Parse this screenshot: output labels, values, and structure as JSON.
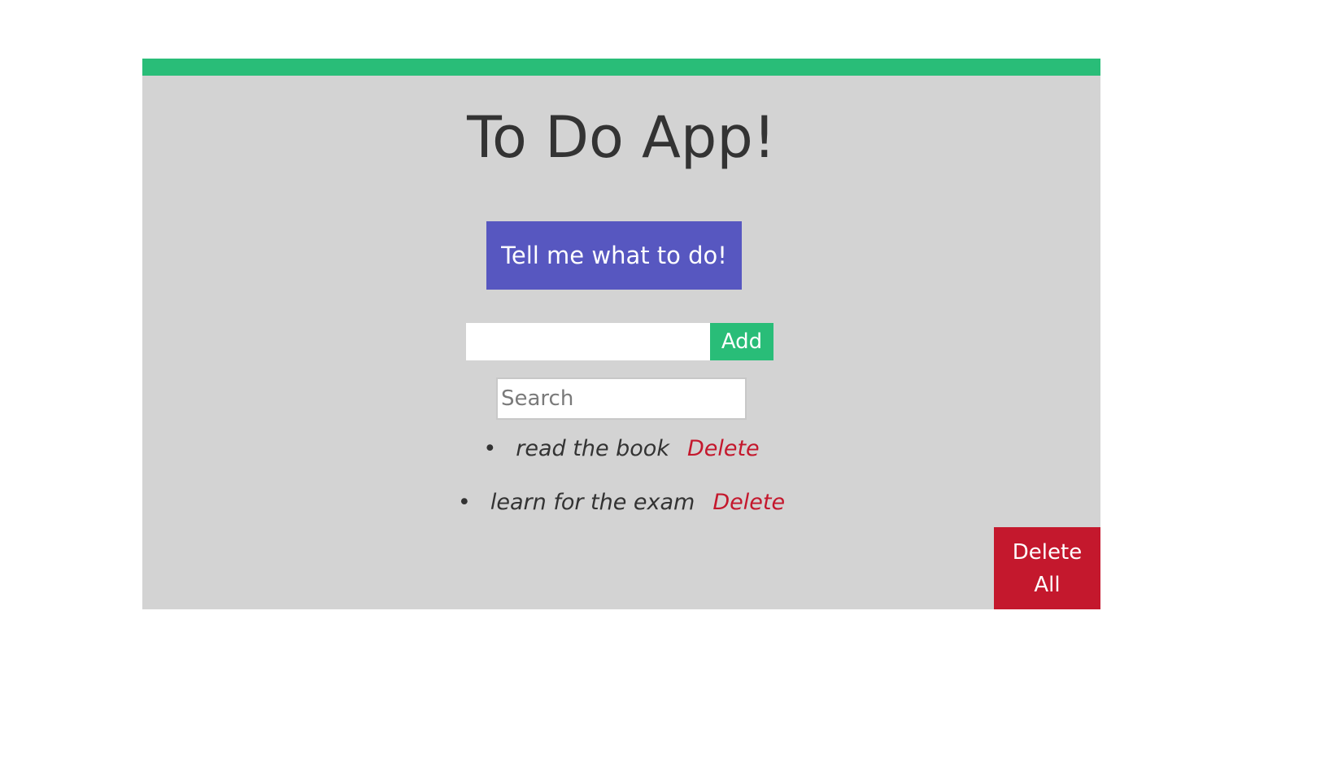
{
  "app": {
    "title": "To Do App!",
    "suggest_button_label": "Tell me what to do!",
    "task_input": {
      "value": "",
      "placeholder": ""
    },
    "add_button_label": "Add",
    "search": {
      "value": "",
      "placeholder": "Search"
    },
    "todos": [
      {
        "bullet": "•",
        "text": "read the book",
        "delete_label": "Delete"
      },
      {
        "bullet": "•",
        "text": "learn for the exam",
        "delete_label": "Delete"
      }
    ],
    "delete_all_label": "Delete All"
  },
  "colors": {
    "accent_green": "#29bd78",
    "panel_gray": "#d3d3d3",
    "suggest_purple": "#5757c0",
    "danger_red": "#c4182d",
    "text_dark": "#333333"
  }
}
